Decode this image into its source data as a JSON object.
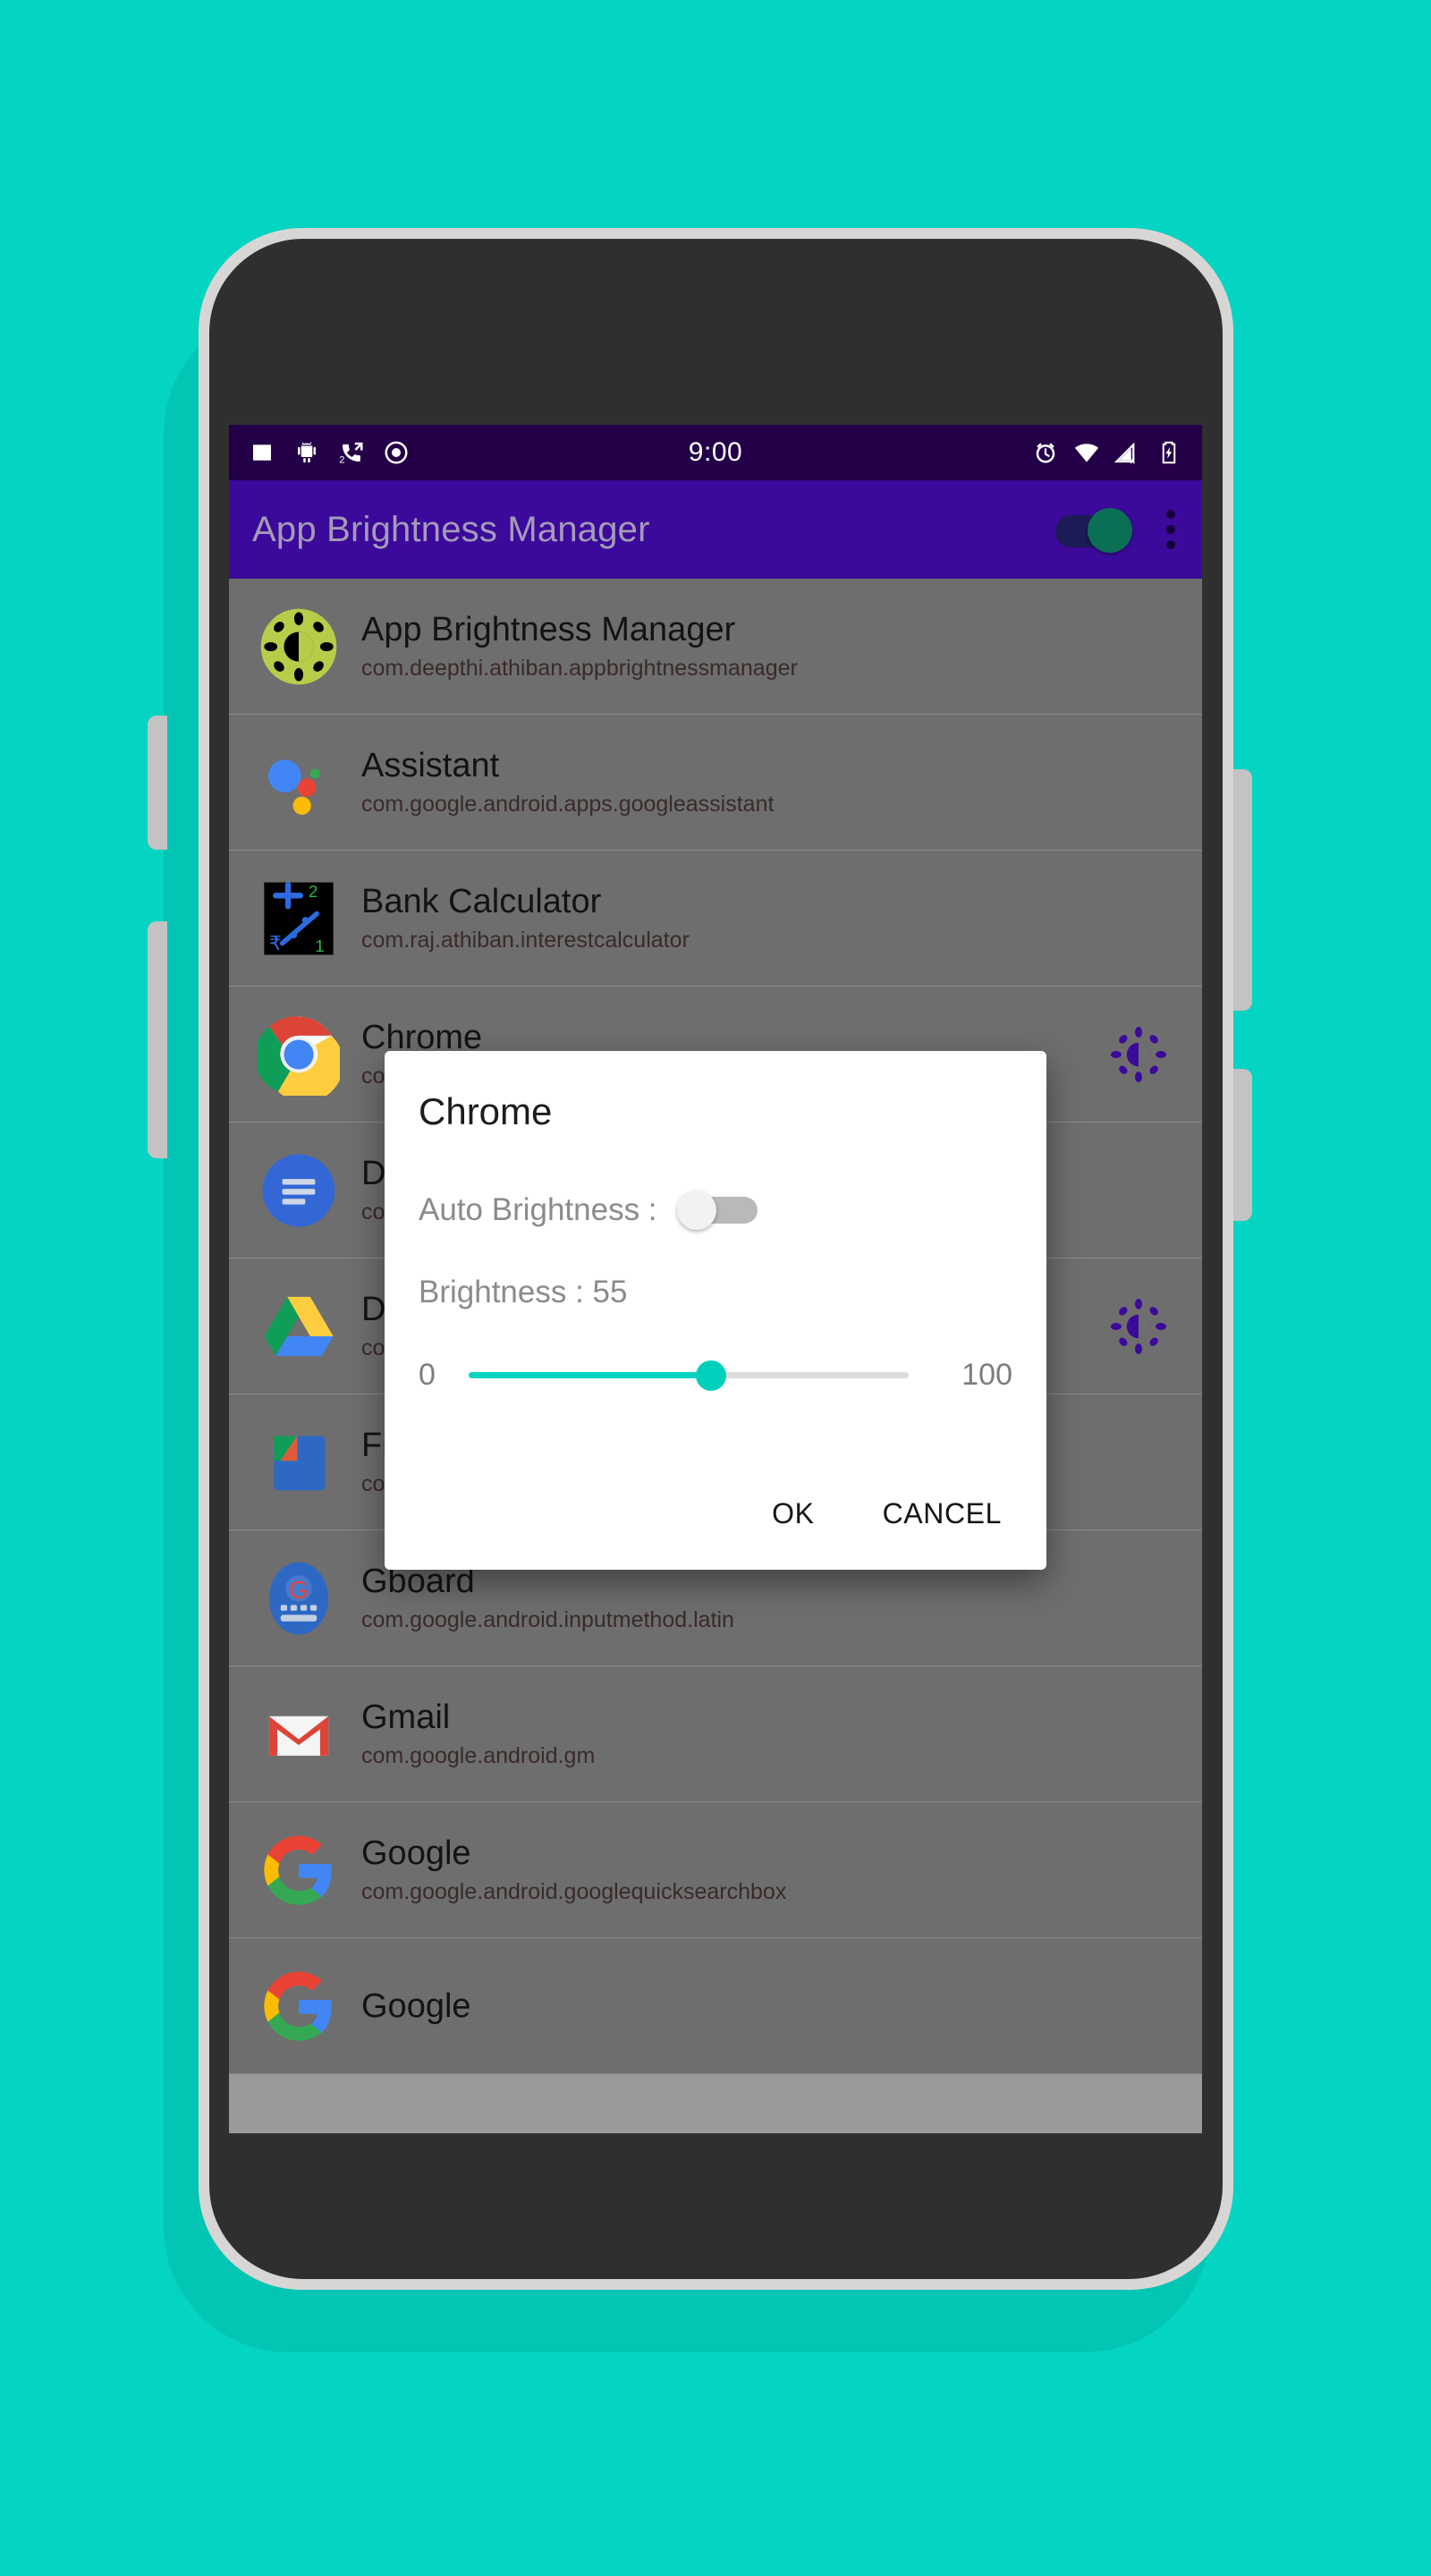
{
  "background_color": "#04D4C2",
  "device": {
    "frame_color": "#d8d6d4",
    "body_color": "#2f2f2f"
  },
  "status_bar": {
    "time": "9:00",
    "background": "#230048",
    "left_icons": [
      "image-icon",
      "android-icon",
      "call-forward-icon",
      "record-icon"
    ],
    "call_forward_badge": "2",
    "right_icons": [
      "alarm-icon",
      "wifi-icon",
      "no-sim-signal-icon",
      "battery-charging-icon"
    ]
  },
  "app_bar": {
    "title": "App Brightness Manager",
    "background": "#3B0A9B",
    "title_color": "#a59bb6",
    "master_toggle": {
      "name": "master-toggle",
      "state": "on",
      "thumb_color": "#0a6f55"
    },
    "overflow_menu": "overflow-menu-icon"
  },
  "app_list": [
    {
      "title": "App Brightness Manager",
      "package": "com.deepthi.athiban.appbrightnessmanager",
      "icon": "app-brightness-manager-icon",
      "has_brightness_badge": false
    },
    {
      "title": "Assistant",
      "package": "com.google.android.apps.googleassistant",
      "icon": "google-assistant-icon",
      "has_brightness_badge": false
    },
    {
      "title": "Bank Calculator",
      "package": "com.raj.athiban.interestcalculator",
      "icon": "bank-calculator-icon",
      "has_brightness_badge": false
    },
    {
      "title": "Chrome",
      "package": "com.android.chrome",
      "icon": "chrome-icon",
      "has_brightness_badge": true
    },
    {
      "title": "Docs",
      "package": "com.google.android.apps.docs.editors.docs",
      "icon": "google-docs-icon",
      "has_brightness_badge": false
    },
    {
      "title": "Drive",
      "package": "com.google.android.apps.docs",
      "icon": "google-drive-icon",
      "has_brightness_badge": true
    },
    {
      "title": "Files",
      "package": "com.google.android.apps.nbu.files",
      "icon": "google-files-icon",
      "has_brightness_badge": false
    },
    {
      "title": "Gboard",
      "package": "com.google.android.inputmethod.latin",
      "icon": "gboard-icon",
      "has_brightness_badge": false
    },
    {
      "title": "Gmail",
      "package": "com.google.android.gm",
      "icon": "gmail-icon",
      "has_brightness_badge": false
    },
    {
      "title": "Google",
      "package": "com.google.android.googlequicksearchbox",
      "icon": "google-icon",
      "has_brightness_badge": false
    },
    {
      "title": "Google",
      "package": "",
      "icon": "google-icon",
      "has_brightness_badge": false
    }
  ],
  "dialog": {
    "title": "Chrome",
    "auto_brightness_label": "Auto Brightness :",
    "auto_brightness_state": "off",
    "brightness_label": "Brightness : 55",
    "brightness_value": 55,
    "slider_min_label": "0",
    "slider_max_label": "100",
    "slider_min": 0,
    "slider_max": 100,
    "accent_color": "#00CFBC",
    "ok_label": "OK",
    "cancel_label": "CANCEL"
  }
}
